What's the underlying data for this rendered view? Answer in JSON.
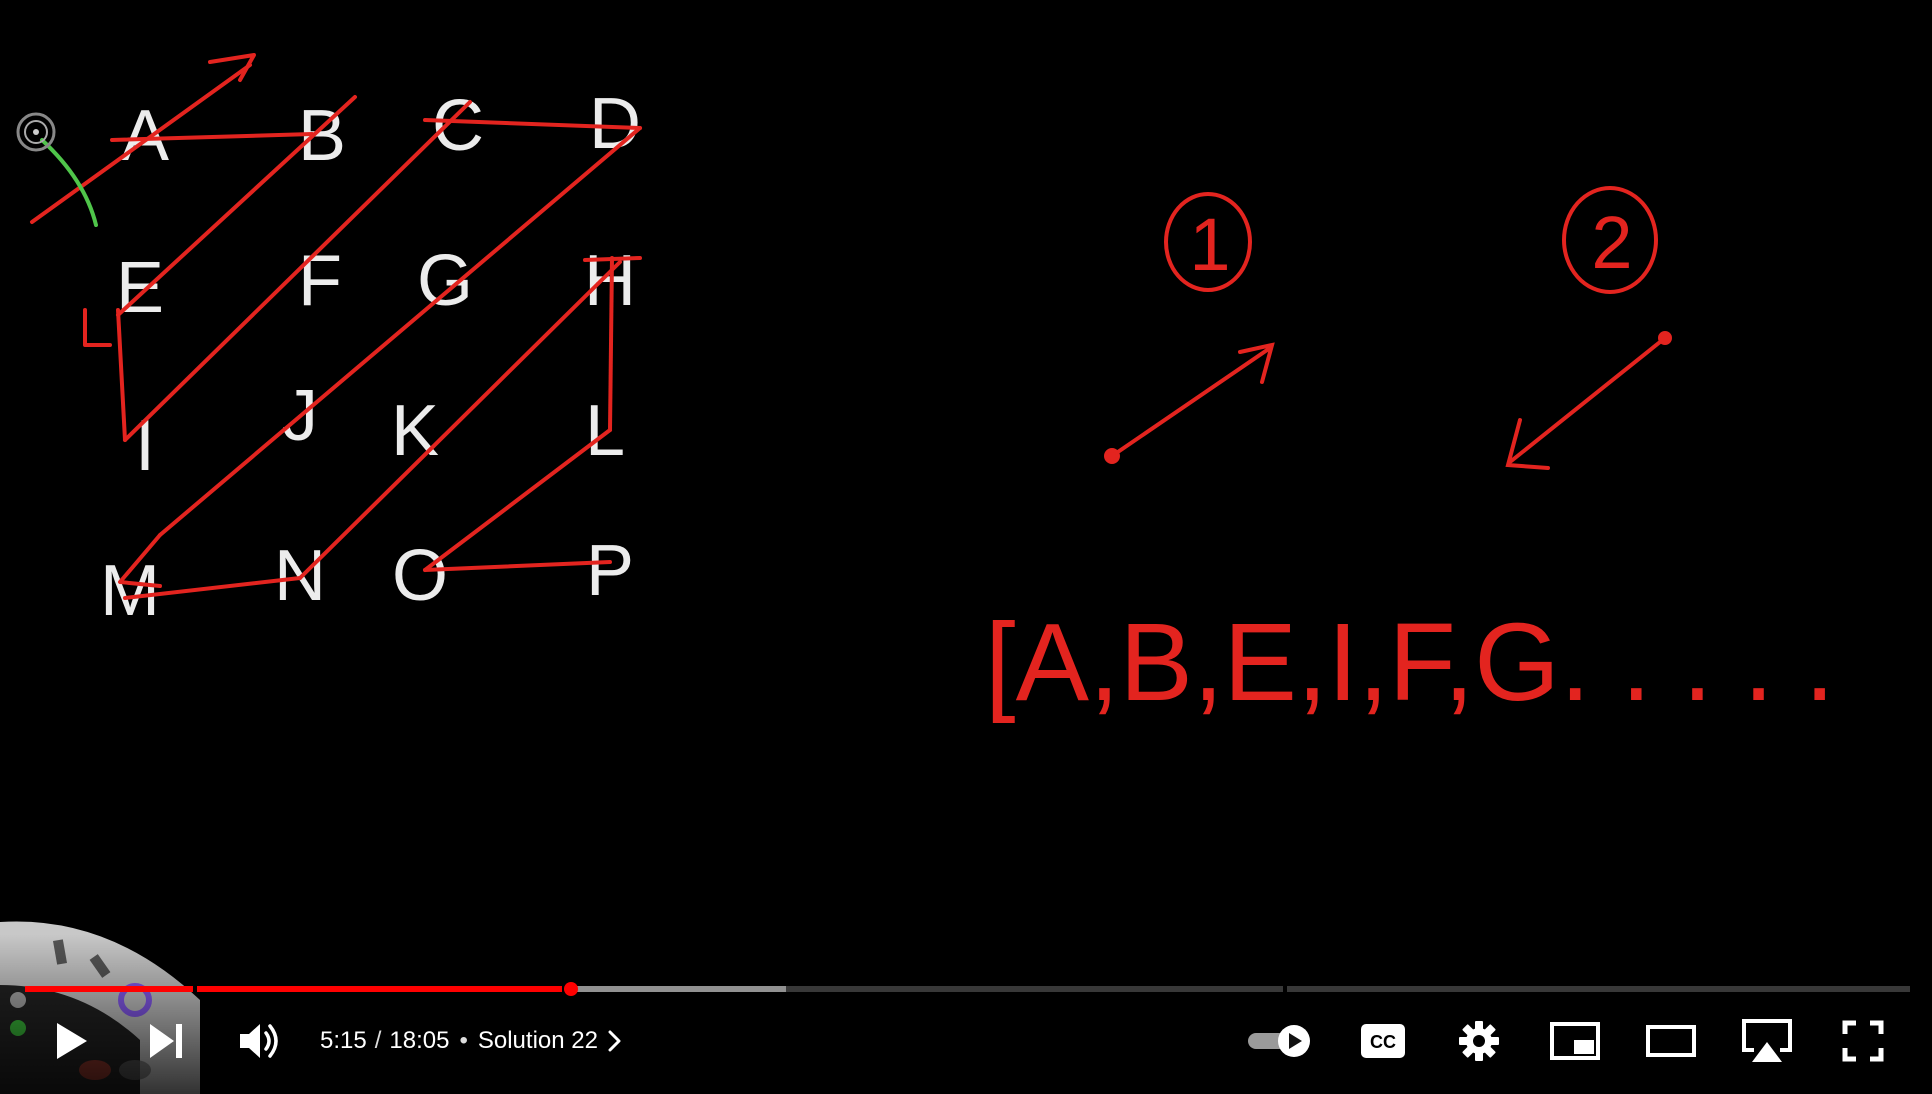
{
  "player": {
    "current_time": "5:15",
    "time_separator": "/",
    "duration": "18:05",
    "chapter_title": "Solution 22",
    "chapter_dot": "•",
    "played_fraction": 0.29,
    "buffered_fraction": 0.4,
    "accent_color": "#ff0000"
  },
  "board": {
    "grid_letters": [
      "A",
      "B",
      "C",
      "D",
      "E",
      "F",
      "G",
      "H",
      "I",
      "J",
      "K",
      "L",
      "M",
      "N",
      "O",
      "P"
    ],
    "step_one": "1",
    "step_two": "2",
    "sequence_text": "[A,B,E,I,F,G. . . . ."
  },
  "controls": {
    "icons": [
      "play-icon",
      "next-icon",
      "volume-icon",
      "autoplay-toggle-icon",
      "captions-icon",
      "settings-icon",
      "miniplayer-icon",
      "theater-icon",
      "airplay-icon",
      "fullscreen-icon"
    ]
  }
}
